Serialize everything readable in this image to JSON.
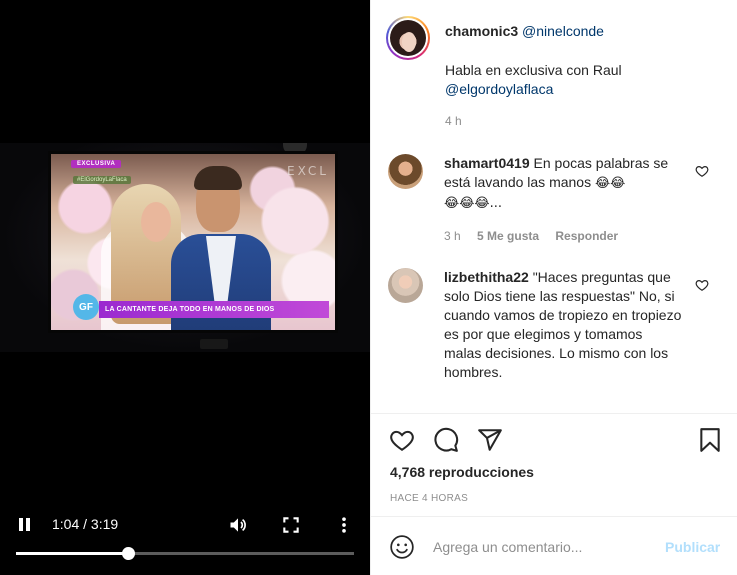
{
  "video": {
    "tv_badge": "EXCLUSIVA",
    "tv_hashtag": "#ElGordoyLaFlaca",
    "tv_corner_text": "EXCL",
    "tv_logo": "GF",
    "tv_lower_third": "LA CANTANTE DEJA TODO EN MANOS DE DIOS",
    "time_display": "1:04 / 3:19",
    "progress_fraction": 0.33,
    "icons": {
      "play_state": "pause-icon",
      "volume": "volume-icon",
      "fullscreen": "fullscreen-icon",
      "more": "more-options-icon"
    }
  },
  "post": {
    "author": "chamonic3",
    "mention": "@ninelconde",
    "caption_text": "Habla en exclusiva con Raul",
    "caption_mention": "@elgordoylaflaca",
    "time": "4 h"
  },
  "comments": [
    {
      "username": "shamart0419",
      "text_line1": "En pocas palabras se está lavando las manos",
      "emojis_line1": "😂😂",
      "emojis_line2": "😂😂😂...",
      "time": "3 h",
      "likes": "5 Me gusta",
      "reply": "Responder"
    },
    {
      "username": "lizbethitha22",
      "text": "\"Haces preguntas que solo Dios tiene las respuestas\" No, si cuando vamos de tropiezo en tropiezo es por que elegimos y tomamos malas decisiones. Lo mismo con los hombres."
    }
  ],
  "actions": {
    "icons": [
      "heart-icon",
      "comment-icon",
      "share-icon",
      "bookmark-icon"
    ],
    "views": "4,768 reproducciones",
    "posted": "HACE 4 HORAS"
  },
  "comment_box": {
    "placeholder": "Agrega un comentario...",
    "publish_label": "Publicar",
    "publish_color": "#b2dffc"
  },
  "colors": {
    "mention": "#00376b",
    "muted": "#8e8e8e",
    "text": "#262626"
  }
}
